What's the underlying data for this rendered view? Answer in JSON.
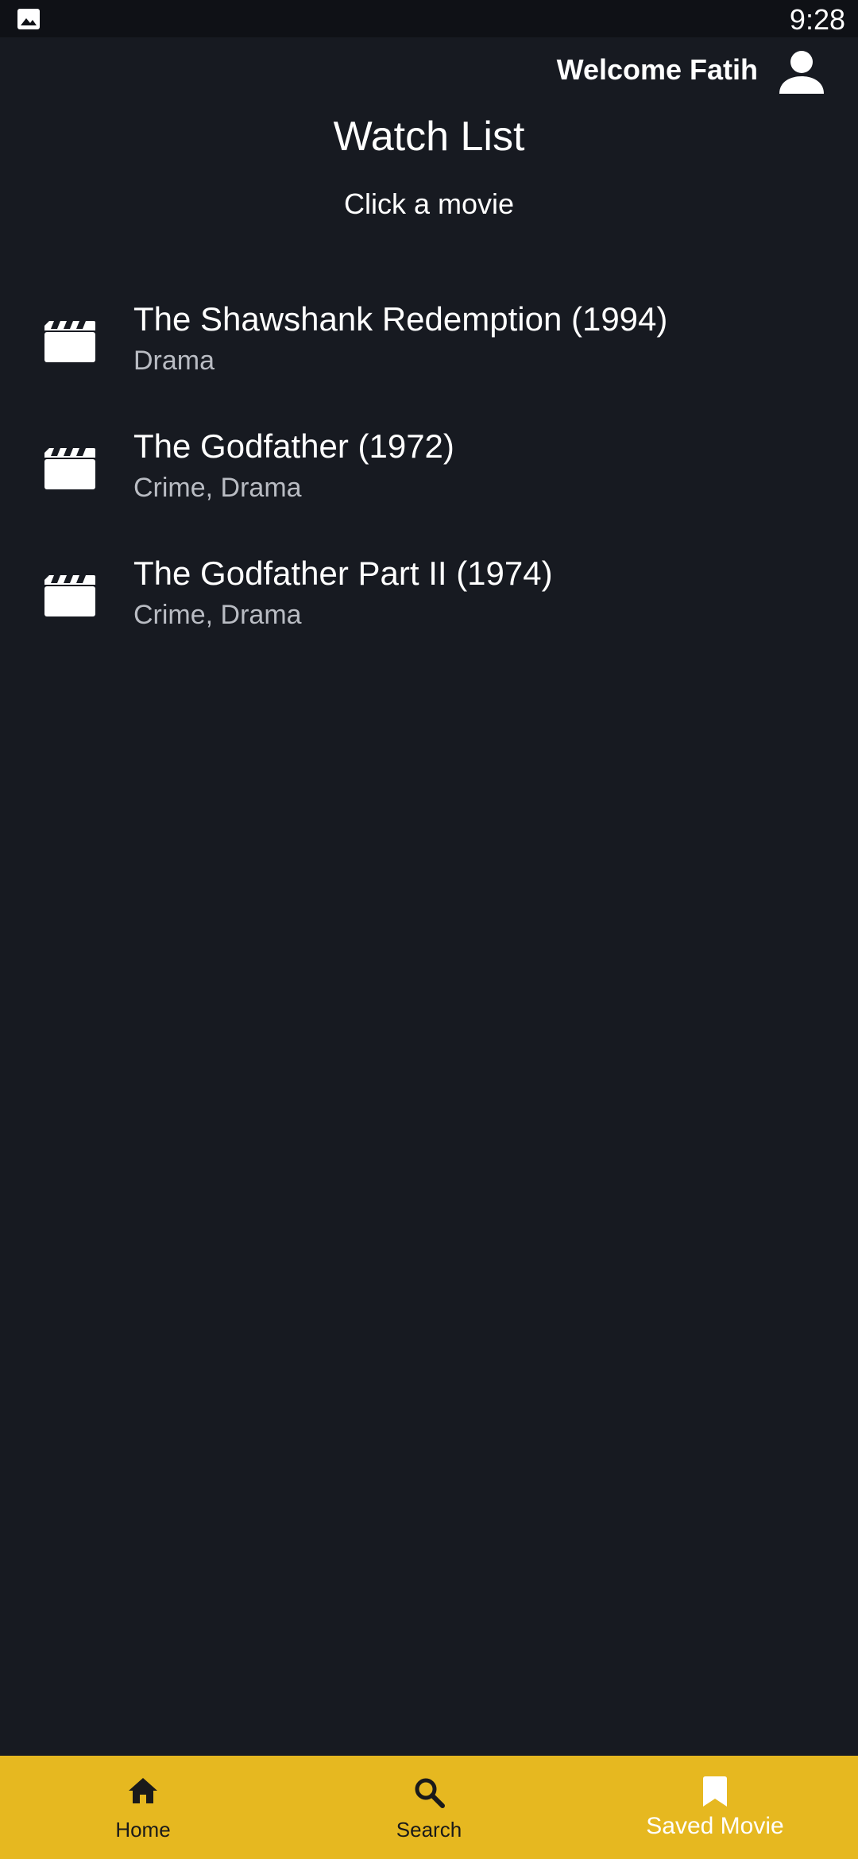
{
  "status_bar": {
    "time": "9:28",
    "notification_icon": "gallery-icon"
  },
  "header": {
    "welcome_text": "Welcome Fatih",
    "profile_icon": "person-icon"
  },
  "page": {
    "title": "Watch List",
    "subtitle": "Click a movie"
  },
  "movies": [
    {
      "title": "The Shawshank Redemption (1994)",
      "genre": "Drama",
      "icon": "movie-clapper-icon"
    },
    {
      "title": "The Godfather (1972)",
      "genre": "Crime, Drama",
      "icon": "movie-clapper-icon"
    },
    {
      "title": "The Godfather Part II (1974)",
      "genre": "Crime, Drama",
      "icon": "movie-clapper-icon"
    }
  ],
  "bottom_nav": {
    "items": [
      {
        "label": "Home",
        "icon": "home-icon",
        "active": false
      },
      {
        "label": "Search",
        "icon": "search-icon",
        "active": false
      },
      {
        "label": "Saved Movie",
        "icon": "bookmark-icon",
        "active": true
      }
    ]
  },
  "colors": {
    "background": "#171a21",
    "status_bar": "#0f1116",
    "nav_bar": "#e6b820",
    "active_nav_label": "#ffffff",
    "inactive_nav_label": "#1a1a1a",
    "secondary_text": "#b9bcc3"
  }
}
